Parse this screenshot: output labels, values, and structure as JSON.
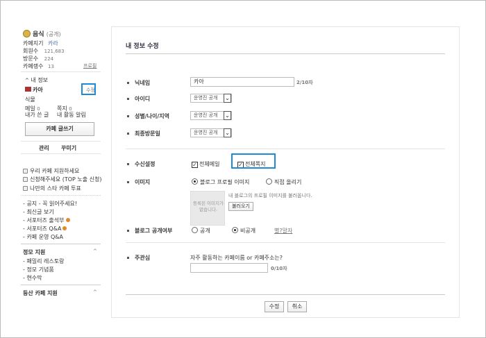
{
  "sidebar": {
    "cafe_name": "음식",
    "cafe_visibility": "(공개)",
    "manager_label": "카페지기",
    "manager_value": "카라",
    "members_label": "회원수",
    "members_value": "121,683",
    "visitors_label": "방문수",
    "visitors_value": "224",
    "level_label": "카페랭수",
    "level_value": "13",
    "profile_link": "프로필",
    "my_info_label": "내 정보",
    "nickname": "카아",
    "edit_link": "수정",
    "grade": "식물",
    "mail_label": "메일",
    "mail_value": "0",
    "note_label": "쪽지",
    "note_value": "0",
    "my_posts": "내가 쓴 글",
    "my_activity": "내 활동 알림",
    "write_button": "카페 글쓰기",
    "tab_manage": "관리",
    "tab_decorate": "꾸미기",
    "promo_links": [
      "우리 카페 지원하세요",
      "신청해주세요 (TOP 노출 신청)",
      "나만의 스타 카페 투표"
    ],
    "menu_links": [
      "공지 - 꼭 읽어주세요!",
      "최신글 보기",
      "서포터즈 출석부",
      "서포터즈 Q&A",
      "카페 운영 Q&A"
    ],
    "group1_title": "정모 지원",
    "group1_items": [
      "패밀리 레스토랑",
      "정모 기념품",
      "현수막"
    ],
    "group2_title": "등산 카페 지원"
  },
  "main": {
    "title": "내 정보 수정",
    "nickname_label": "닉네임",
    "nickname_value": "카아",
    "nickname_count": "2/10자",
    "id_label": "아이디",
    "id_select": "운영진 공개",
    "gender_label": "성별/나이/지역",
    "gender_select": "운영진 공개",
    "lastvisit_label": "최종방문일",
    "lastvisit_select": "운영진 공개",
    "receive_label": "수신설정",
    "receive_mail": "전체메일",
    "receive_note": "전체쪽지",
    "image_label": "이미지",
    "image_opt1": "블로그 프로필 이미지",
    "image_opt2": "직접 올리기",
    "image_placeholder": "등록된 이미지가 없습니다.",
    "image_note": "내 블로그의 프로필 이미지를 불러옵니다.",
    "image_note_link": "내 블로그",
    "load_button": "불러오기",
    "blog_label": "블로그 공개여부",
    "blog_opt1": "공개",
    "blog_opt2": "비공개",
    "blog_help": "별?말자",
    "interest_label": "주관심",
    "interest_question": "자주 활동하는 카페이름 or 카페주소는?",
    "interest_count": "0/10자",
    "submit_button": "수정",
    "cancel_button": "취소"
  },
  "colors": {
    "highlight": "#1e88d9",
    "link": "#4a6fb5",
    "coin": "#d9b44a"
  }
}
